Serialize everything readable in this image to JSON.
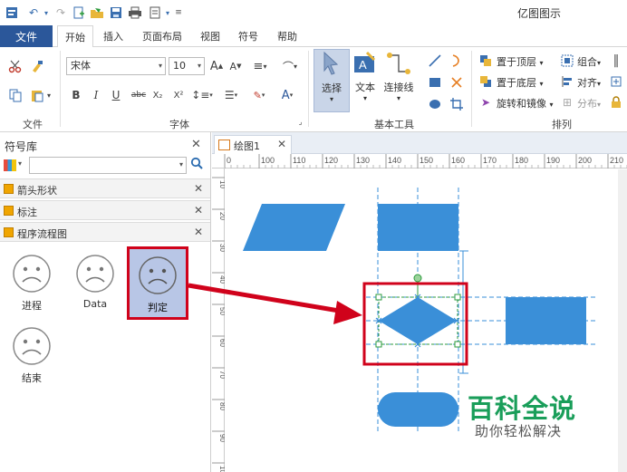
{
  "app": {
    "title": "亿图图示"
  },
  "menu": {
    "file": "文件",
    "tabs": [
      "开始",
      "插入",
      "页面布局",
      "视图",
      "符号",
      "帮助"
    ],
    "active": "开始"
  },
  "ribbon": {
    "font_name": "宋体",
    "font_size": "10",
    "groups": {
      "file": "文件",
      "font": "字体",
      "basic_tools": "基本工具",
      "arrange": "排列"
    },
    "tools": {
      "select": "选择",
      "text": "文本",
      "connector": "连接线"
    },
    "arrange": {
      "bring_front": "置于顶层",
      "send_back": "置于底层",
      "rotate_mirror": "旋转和镜像",
      "group": "组合",
      "align": "对齐",
      "distribute": "分布"
    },
    "format_buttons": [
      "B",
      "I",
      "U",
      "abc",
      "X₂",
      "X²"
    ]
  },
  "library": {
    "title": "符号库",
    "sections": [
      "箭头形状",
      "标注",
      "程序流程图"
    ],
    "shapes": [
      "进程",
      "Data",
      "判定",
      "结束"
    ]
  },
  "document": {
    "tab": "绘图1",
    "ruler_h": [
      "0",
      "100",
      "110",
      "120",
      "130",
      "140",
      "150",
      "160",
      "170",
      "180",
      "190",
      "200",
      "210"
    ],
    "ruler_v": [
      "10",
      "20",
      "30",
      "40",
      "50",
      "60",
      "70",
      "80",
      "90",
      "100"
    ]
  },
  "watermark": {
    "line1": "百科全说",
    "line2": "助你轻松解决"
  },
  "colors": {
    "accent": "#2b579a",
    "shape_fill": "#3a8fd8",
    "highlight": "#d0021b",
    "select_bg": "#b8c6e6",
    "watermark_green": "#1a9e5a"
  }
}
